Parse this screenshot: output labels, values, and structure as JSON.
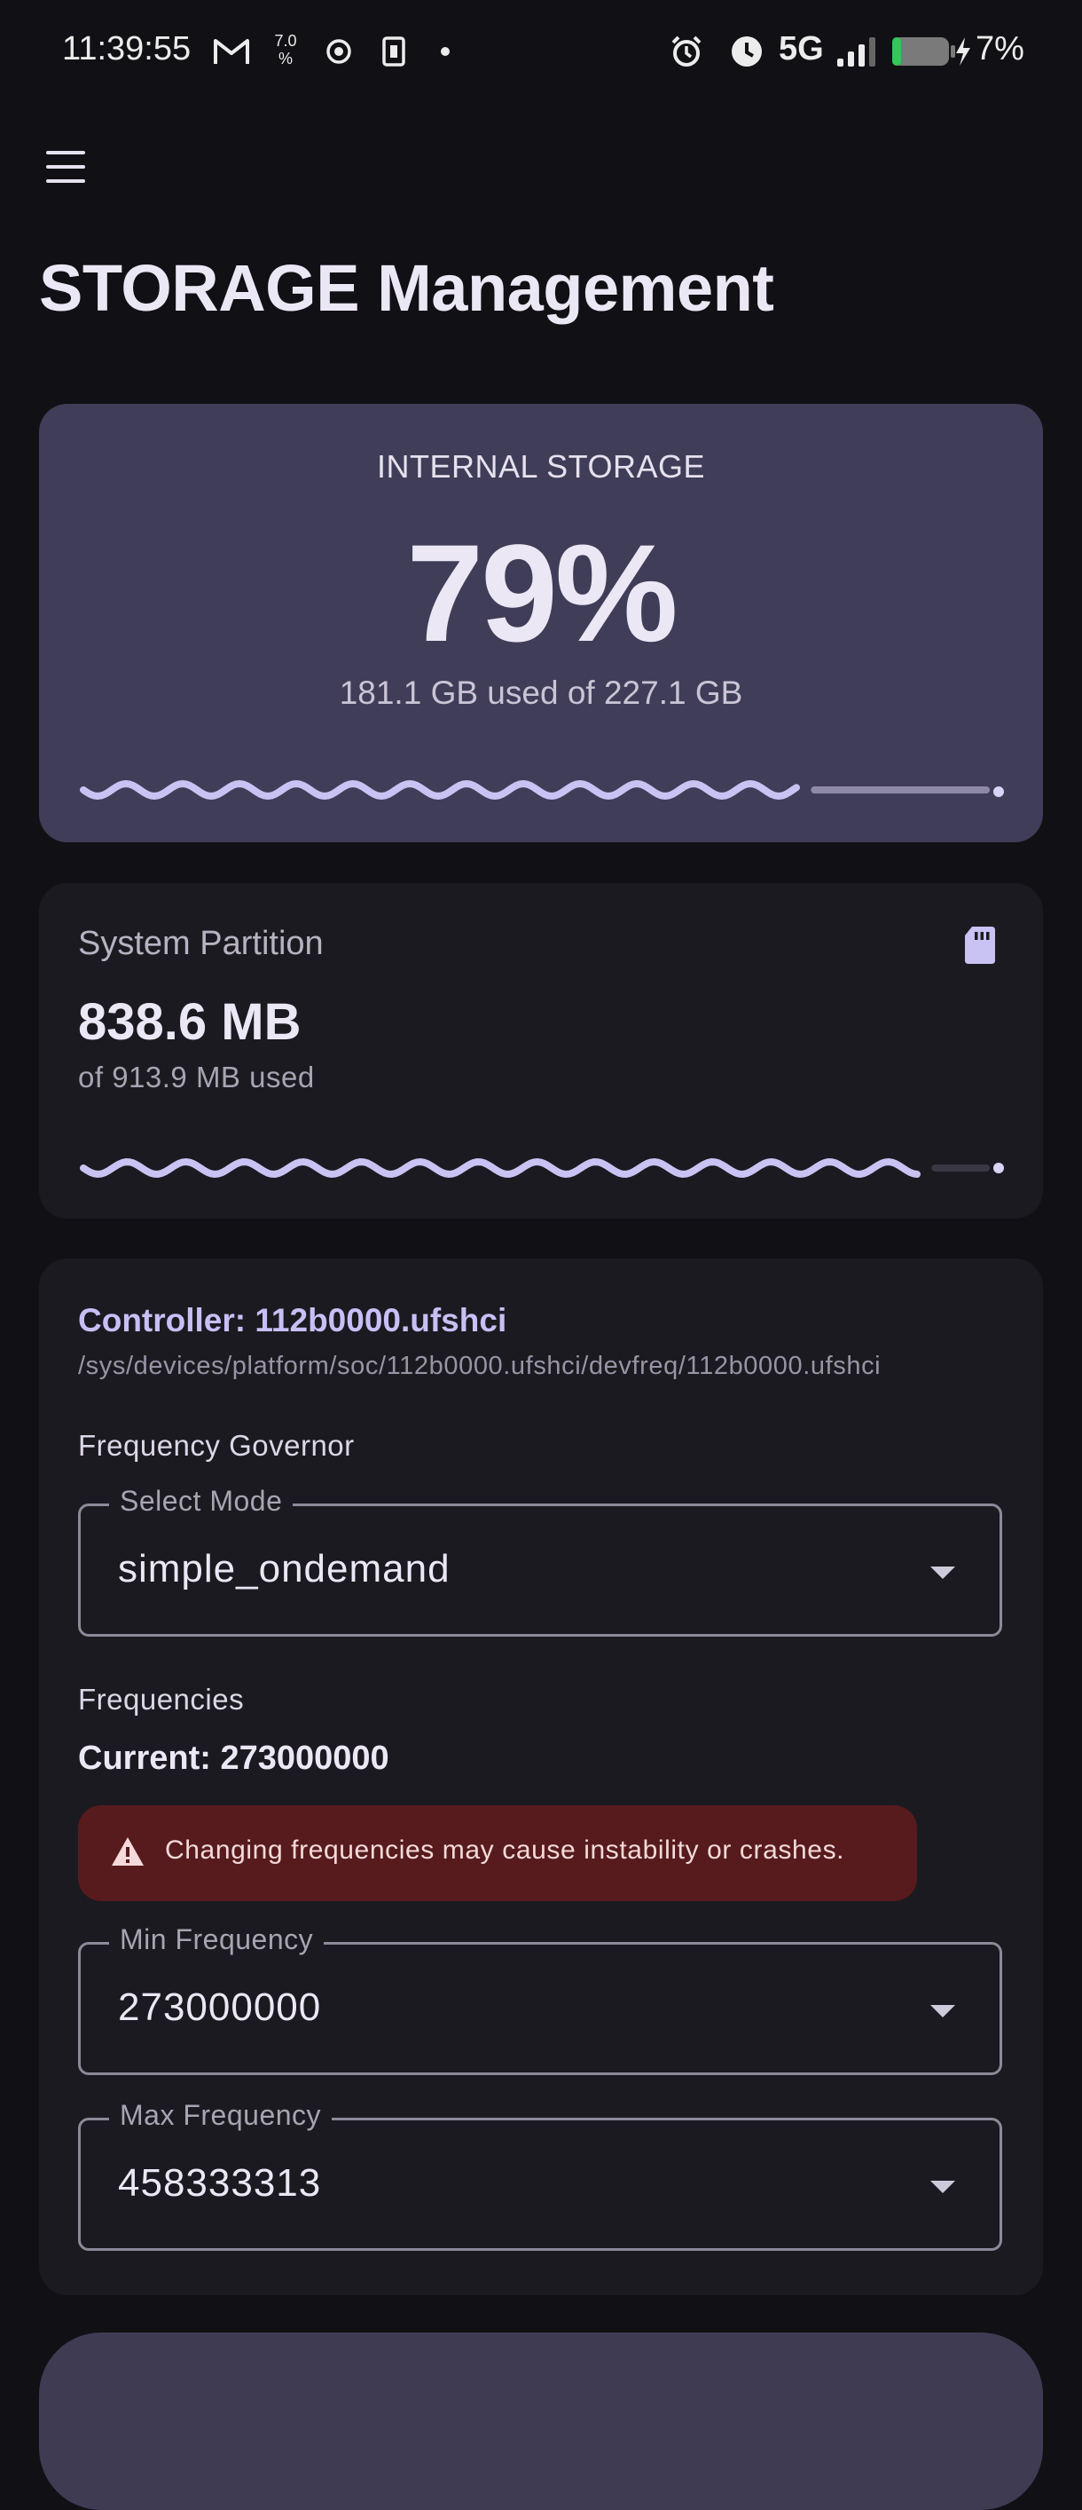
{
  "status_bar": {
    "time": "11:39:55",
    "network": "5G",
    "battery": "7%",
    "data_speed_top": "7.0",
    "data_speed_unit": "%",
    "icons": [
      "gmail-icon",
      "data-speed-icon",
      "record-icon",
      "sim-icon",
      "dot-icon",
      "alarm-icon",
      "clock-icon",
      "signal-icon",
      "battery-icon",
      "charging-icon"
    ]
  },
  "app_bar": {
    "menu_icon": "hamburger-menu-icon",
    "title": "STORAGE Management"
  },
  "internal_storage": {
    "label": "INTERNAL STORAGE",
    "percent": "79%",
    "usage": "181.1 GB used of 227.1 GB",
    "progress": 0.79,
    "indicator_color": "#C9C3F3"
  },
  "system_partition": {
    "label": "System Partition",
    "value": "838.6 MB",
    "sub": "of 913.9 MB used",
    "icon": "sd-card-icon",
    "progress": 0.92
  },
  "controller": {
    "title": "Controller: 112b0000.ufshci",
    "path": "/sys/devices/platform/soc/112b0000.ufshci/devfreq/112b0000.ufshci",
    "governor_label": "Frequency Governor",
    "governor_field": {
      "legend": "Select Mode",
      "value": "simple_ondemand"
    },
    "frequencies_label": "Frequencies",
    "current": "Current: 273000000",
    "warning": "Changing frequencies may cause instability or crashes.",
    "warning_icon": "warning-triangle-icon",
    "min_field": {
      "legend": "Min Frequency",
      "value": "273000000"
    },
    "max_field": {
      "legend": "Max Frequency",
      "value": "458333313"
    }
  },
  "colors": {
    "background": "#111115",
    "primary_card": "#403D58",
    "surface_card": "#1B1A20",
    "accent": "#C7BFF5",
    "warning_bg": "#571B1D"
  }
}
